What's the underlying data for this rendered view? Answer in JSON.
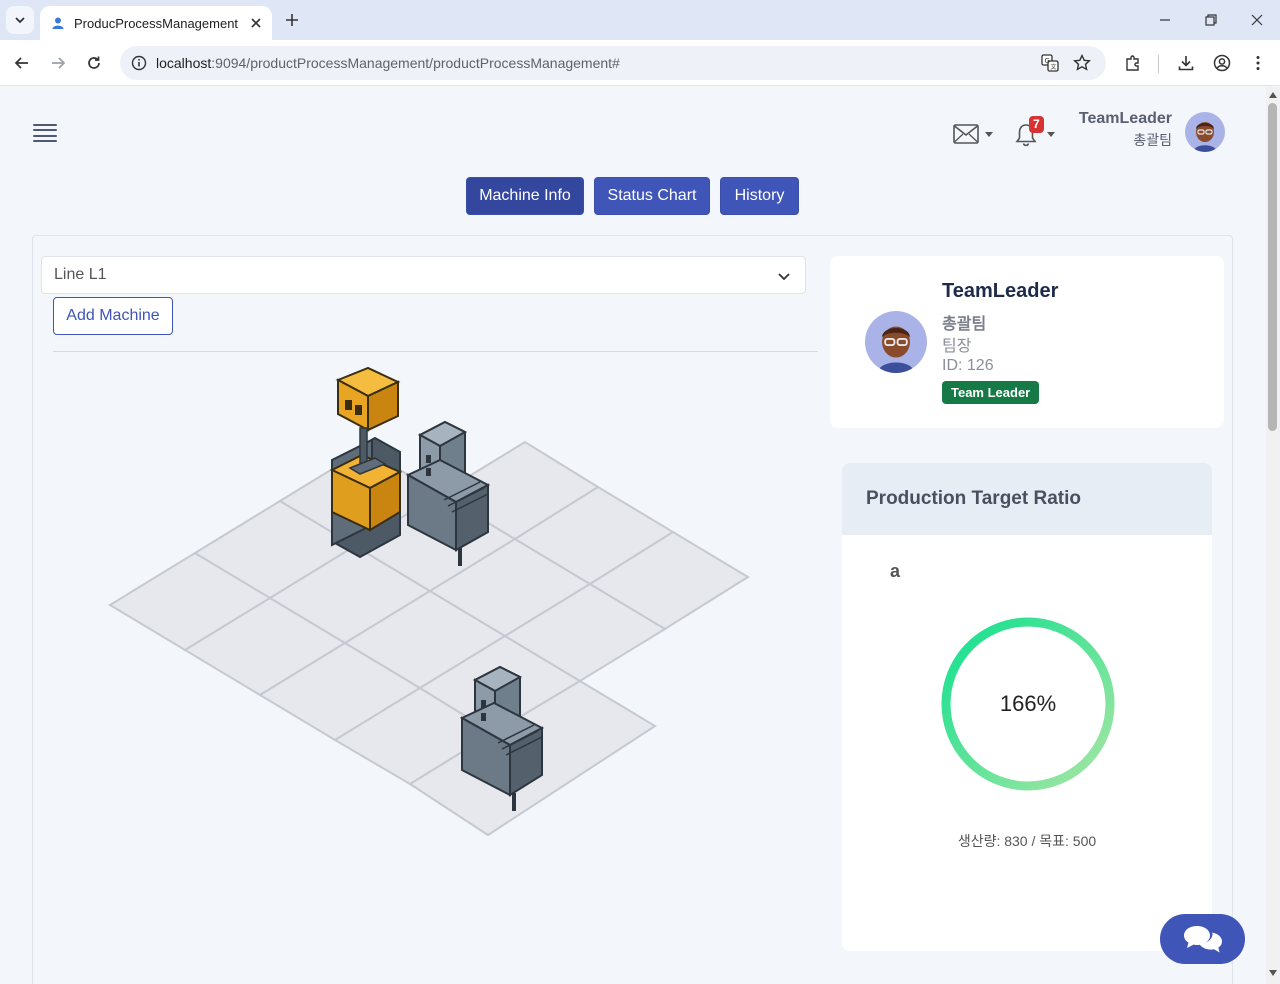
{
  "browser": {
    "tab_title": "ProducProcessManagement",
    "url_host": "localhost",
    "url_path": ":9094/productProcessManagement/productProcessManagement#"
  },
  "header": {
    "notification_count": "7",
    "user_name": "TeamLeader",
    "user_team": "총괄팀"
  },
  "nav_buttons": {
    "machine_info": "Machine Info",
    "status_chart": "Status Chart",
    "history": "History"
  },
  "line_selector": {
    "selected": "Line L1"
  },
  "add_machine_label": "Add Machine",
  "profile": {
    "name": "TeamLeader",
    "team": "총괄팀",
    "role": "팀장",
    "id": "ID: 126",
    "badge": "Team Leader"
  },
  "production_target": {
    "title": "Production Target Ratio",
    "label": "a",
    "ratio_text": "166%",
    "ratio_fraction": 1.0,
    "caption": "생산량: 830 / 목표: 500",
    "produced": 830,
    "target": 500
  },
  "colors": {
    "primary": "#3f55b8",
    "badge_green": "#157a45",
    "gauge_start": "#a8e6a3",
    "gauge_end": "#11e08f"
  },
  "icons": {
    "tab_dropdown": "chevron-down-icon",
    "favicon": "person-icon",
    "mail": "envelope-icon",
    "bell": "bell-icon",
    "chat": "chat-bubbles-icon"
  }
}
